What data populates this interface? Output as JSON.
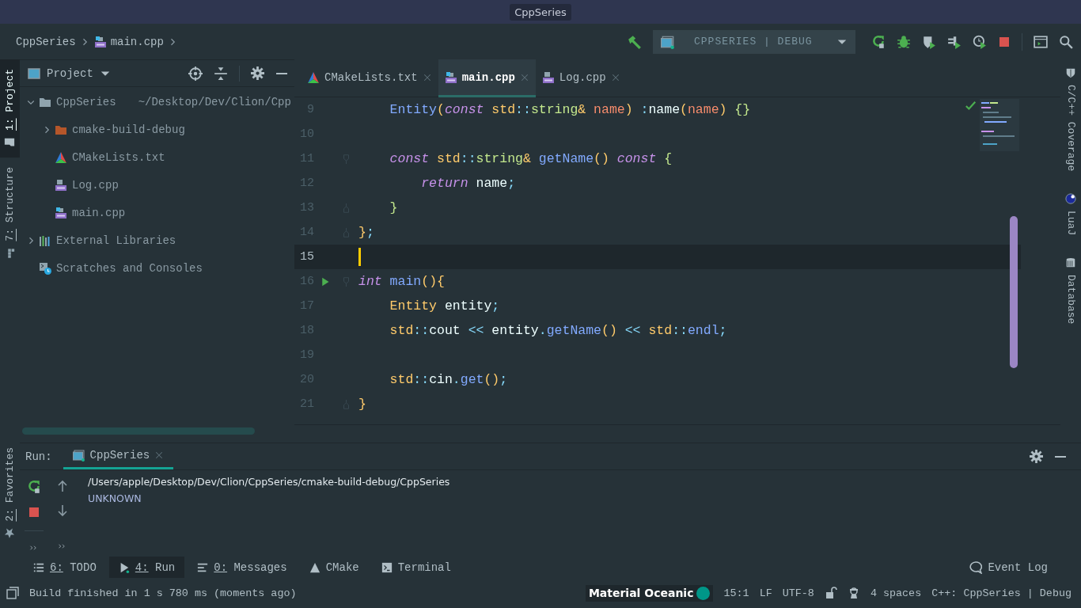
{
  "window": {
    "title": "CppSeries"
  },
  "breadcrumb": [
    {
      "label": "CppSeries",
      "kind": "project"
    },
    {
      "label": "main.cpp",
      "kind": "cpp-main"
    }
  ],
  "run_config": {
    "label": "CPPSERIES | DEBUG"
  },
  "left_stripe": [
    {
      "label": "1: Project",
      "kind": "folder",
      "selected": true
    },
    {
      "label": "7: Structure",
      "kind": "structure",
      "selected": false
    }
  ],
  "left_stripe_bottom": [
    {
      "label": "2: Favorites",
      "kind": "star",
      "selected": false
    }
  ],
  "project": {
    "title": "Project",
    "tree": [
      {
        "label": "CppSeries",
        "path": "~/Desktop/Dev/Clion/Cpp",
        "kind": "folder",
        "expanded": true,
        "children": [
          {
            "label": "cmake-build-debug",
            "kind": "build-folder",
            "expanded": false
          },
          {
            "label": "CMakeLists.txt",
            "kind": "cmake"
          },
          {
            "label": "Log.cpp",
            "kind": "cpp"
          },
          {
            "label": "main.cpp",
            "kind": "cpp-main"
          }
        ]
      },
      {
        "label": "External Libraries",
        "kind": "libraries",
        "expanded": false
      },
      {
        "label": "Scratches and Consoles",
        "kind": "scratches"
      }
    ]
  },
  "editor": {
    "tabs": [
      {
        "label": "CMakeLists.txt",
        "kind": "cmake",
        "selected": false
      },
      {
        "label": "main.cpp",
        "kind": "cpp-main",
        "selected": true
      },
      {
        "label": "Log.cpp",
        "kind": "cpp",
        "selected": false
      }
    ],
    "lines": [
      {
        "number": "9",
        "current": false,
        "run": false,
        "fold_start": false,
        "fold_end": false,
        "tokens": [
          {
            "text": "    Entity",
            "kind": "fn"
          },
          {
            "text": "(",
            "kind": "type"
          },
          {
            "text": "const",
            "kind": "kw"
          },
          {
            "text": " std",
            "kind": "type"
          },
          {
            "text": "::",
            "kind": "op"
          },
          {
            "text": "string",
            "kind": "str"
          },
          {
            "text": "&",
            "kind": "type"
          },
          {
            "text": " name",
            "kind": "param"
          },
          {
            "text": ")",
            "kind": "type"
          },
          {
            "text": " :",
            "kind": "op"
          },
          {
            "text": "name",
            "kind": "plain"
          },
          {
            "text": "(",
            "kind": "type"
          },
          {
            "text": "name",
            "kind": "param"
          },
          {
            "text": ")",
            "kind": "type"
          },
          {
            "text": " {}",
            "kind": "str"
          }
        ]
      },
      {
        "number": "10",
        "current": false,
        "run": false,
        "fold_start": false,
        "fold_end": false
      },
      {
        "number": "11",
        "current": false,
        "run": false,
        "fold_start": true,
        "fold_end": false,
        "tokens": [
          {
            "text": "    const",
            "kind": "kw"
          },
          {
            "text": " std",
            "kind": "type"
          },
          {
            "text": "::",
            "kind": "op"
          },
          {
            "text": "string",
            "kind": "str"
          },
          {
            "text": "&",
            "kind": "type"
          },
          {
            "text": " getName",
            "kind": "fn"
          },
          {
            "text": "()",
            "kind": "type"
          },
          {
            "text": " const",
            "kind": "kw"
          },
          {
            "text": " {",
            "kind": "str"
          }
        ]
      },
      {
        "number": "12",
        "current": false,
        "run": false,
        "fold_start": false,
        "fold_end": false,
        "tokens": [
          {
            "text": "        return",
            "kind": "kw"
          },
          {
            "text": " name",
            "kind": "plain"
          },
          {
            "text": ";",
            "kind": "op"
          }
        ]
      },
      {
        "number": "13",
        "current": false,
        "run": false,
        "fold_start": false,
        "fold_end": true,
        "tokens": [
          {
            "text": "    }",
            "kind": "str"
          }
        ]
      },
      {
        "number": "14",
        "current": false,
        "run": false,
        "fold_start": false,
        "fold_end": true,
        "tokens": [
          {
            "text": "}",
            "kind": "type"
          },
          {
            "text": ";",
            "kind": "op"
          }
        ]
      },
      {
        "number": "15",
        "current": true,
        "run": false,
        "fold_start": false,
        "fold_end": false
      },
      {
        "number": "16",
        "current": false,
        "run": true,
        "fold_start": true,
        "fold_end": false,
        "tokens": [
          {
            "text": "int",
            "kind": "kw"
          },
          {
            "text": " main",
            "kind": "fn"
          },
          {
            "text": "(){",
            "kind": "type"
          }
        ]
      },
      {
        "number": "17",
        "current": false,
        "run": false,
        "fold_start": false,
        "fold_end": false,
        "tokens": [
          {
            "text": "    Entity",
            "kind": "type"
          },
          {
            "text": " entity",
            "kind": "plain"
          },
          {
            "text": ";",
            "kind": "op"
          }
        ]
      },
      {
        "number": "18",
        "current": false,
        "run": false,
        "fold_start": false,
        "fold_end": false,
        "tokens": [
          {
            "text": "    std",
            "kind": "type"
          },
          {
            "text": "::",
            "kind": "op"
          },
          {
            "text": "cout",
            "kind": "plain"
          },
          {
            "text": " <<",
            "kind": "op"
          },
          {
            "text": " entity",
            "kind": "plain"
          },
          {
            "text": ".",
            "kind": "op"
          },
          {
            "text": "getName",
            "kind": "fn"
          },
          {
            "text": "()",
            "kind": "type"
          },
          {
            "text": " <<",
            "kind": "op"
          },
          {
            "text": " std",
            "kind": "type"
          },
          {
            "text": "::",
            "kind": "op"
          },
          {
            "text": "endl",
            "kind": "fn"
          },
          {
            "text": ";",
            "kind": "op"
          }
        ]
      },
      {
        "number": "19",
        "current": false,
        "run": false,
        "fold_start": false,
        "fold_end": false
      },
      {
        "number": "20",
        "current": false,
        "run": false,
        "fold_start": false,
        "fold_end": false,
        "tokens": [
          {
            "text": "    std",
            "kind": "type"
          },
          {
            "text": "::",
            "kind": "op"
          },
          {
            "text": "cin",
            "kind": "plain"
          },
          {
            "text": ".",
            "kind": "op"
          },
          {
            "text": "get",
            "kind": "fn"
          },
          {
            "text": "()",
            "kind": "type"
          },
          {
            "text": ";",
            "kind": "op"
          }
        ]
      },
      {
        "number": "21",
        "current": false,
        "run": false,
        "fold_start": false,
        "fold_end": true,
        "tokens": [
          {
            "text": "}",
            "kind": "type"
          }
        ]
      }
    ]
  },
  "right_stripe": [
    {
      "label": "C/C++ Coverage",
      "kind": "coverage"
    },
    {
      "label": "LuaJ",
      "kind": "luaj"
    },
    {
      "label": "Database",
      "kind": "database"
    }
  ],
  "run_panel": {
    "title": "Run:",
    "tabs": [
      {
        "label": "CppSeries",
        "selected": true
      }
    ],
    "output": [
      "/Users/apple/Desktop/Dev/Clion/CppSeries/cmake-build-debug/CppSeries",
      "UNKNOWN"
    ]
  },
  "tool_windows": [
    {
      "label": "6: TODO",
      "kind": "todo",
      "selected": false
    },
    {
      "label": "4: Run",
      "kind": "run",
      "selected": true
    },
    {
      "label": "0: Messages",
      "kind": "messages",
      "selected": false
    },
    {
      "label": "CMake",
      "kind": "cmake",
      "selected": false
    },
    {
      "label": "Terminal",
      "kind": "terminal",
      "selected": false
    }
  ],
  "event_log": {
    "label": "Event Log"
  },
  "status_bar": {
    "message": "Build finished in 1 s 780 ms (moments ago)",
    "theme": "Material Oceanic",
    "position": "15:1",
    "line_separator": "LF",
    "encoding": "UTF-8",
    "indent": "4 spaces",
    "context": "C++: CppSeries | Debug"
  }
}
